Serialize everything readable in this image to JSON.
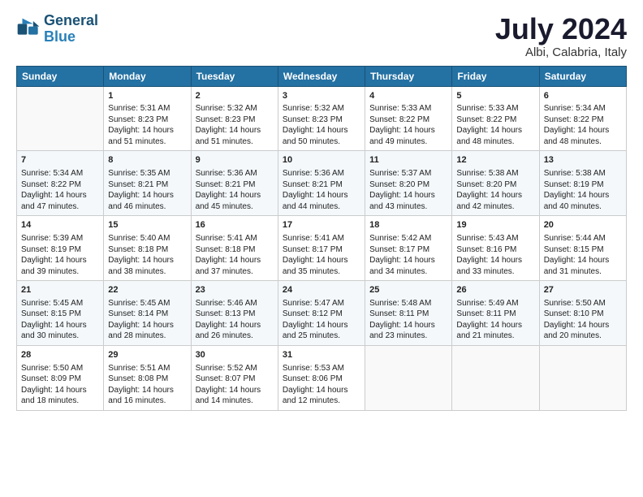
{
  "header": {
    "logo_line1": "General",
    "logo_line2": "Blue",
    "month": "July 2024",
    "location": "Albi, Calabria, Italy"
  },
  "days_of_week": [
    "Sunday",
    "Monday",
    "Tuesday",
    "Wednesday",
    "Thursday",
    "Friday",
    "Saturday"
  ],
  "weeks": [
    [
      {
        "day": "",
        "info": ""
      },
      {
        "day": "1",
        "info": "Sunrise: 5:31 AM\nSunset: 8:23 PM\nDaylight: 14 hours\nand 51 minutes."
      },
      {
        "day": "2",
        "info": "Sunrise: 5:32 AM\nSunset: 8:23 PM\nDaylight: 14 hours\nand 51 minutes."
      },
      {
        "day": "3",
        "info": "Sunrise: 5:32 AM\nSunset: 8:23 PM\nDaylight: 14 hours\nand 50 minutes."
      },
      {
        "day": "4",
        "info": "Sunrise: 5:33 AM\nSunset: 8:22 PM\nDaylight: 14 hours\nand 49 minutes."
      },
      {
        "day": "5",
        "info": "Sunrise: 5:33 AM\nSunset: 8:22 PM\nDaylight: 14 hours\nand 48 minutes."
      },
      {
        "day": "6",
        "info": "Sunrise: 5:34 AM\nSunset: 8:22 PM\nDaylight: 14 hours\nand 48 minutes."
      }
    ],
    [
      {
        "day": "7",
        "info": "Sunrise: 5:34 AM\nSunset: 8:22 PM\nDaylight: 14 hours\nand 47 minutes."
      },
      {
        "day": "8",
        "info": "Sunrise: 5:35 AM\nSunset: 8:21 PM\nDaylight: 14 hours\nand 46 minutes."
      },
      {
        "day": "9",
        "info": "Sunrise: 5:36 AM\nSunset: 8:21 PM\nDaylight: 14 hours\nand 45 minutes."
      },
      {
        "day": "10",
        "info": "Sunrise: 5:36 AM\nSunset: 8:21 PM\nDaylight: 14 hours\nand 44 minutes."
      },
      {
        "day": "11",
        "info": "Sunrise: 5:37 AM\nSunset: 8:20 PM\nDaylight: 14 hours\nand 43 minutes."
      },
      {
        "day": "12",
        "info": "Sunrise: 5:38 AM\nSunset: 8:20 PM\nDaylight: 14 hours\nand 42 minutes."
      },
      {
        "day": "13",
        "info": "Sunrise: 5:38 AM\nSunset: 8:19 PM\nDaylight: 14 hours\nand 40 minutes."
      }
    ],
    [
      {
        "day": "14",
        "info": "Sunrise: 5:39 AM\nSunset: 8:19 PM\nDaylight: 14 hours\nand 39 minutes."
      },
      {
        "day": "15",
        "info": "Sunrise: 5:40 AM\nSunset: 8:18 PM\nDaylight: 14 hours\nand 38 minutes."
      },
      {
        "day": "16",
        "info": "Sunrise: 5:41 AM\nSunset: 8:18 PM\nDaylight: 14 hours\nand 37 minutes."
      },
      {
        "day": "17",
        "info": "Sunrise: 5:41 AM\nSunset: 8:17 PM\nDaylight: 14 hours\nand 35 minutes."
      },
      {
        "day": "18",
        "info": "Sunrise: 5:42 AM\nSunset: 8:17 PM\nDaylight: 14 hours\nand 34 minutes."
      },
      {
        "day": "19",
        "info": "Sunrise: 5:43 AM\nSunset: 8:16 PM\nDaylight: 14 hours\nand 33 minutes."
      },
      {
        "day": "20",
        "info": "Sunrise: 5:44 AM\nSunset: 8:15 PM\nDaylight: 14 hours\nand 31 minutes."
      }
    ],
    [
      {
        "day": "21",
        "info": "Sunrise: 5:45 AM\nSunset: 8:15 PM\nDaylight: 14 hours\nand 30 minutes."
      },
      {
        "day": "22",
        "info": "Sunrise: 5:45 AM\nSunset: 8:14 PM\nDaylight: 14 hours\nand 28 minutes."
      },
      {
        "day": "23",
        "info": "Sunrise: 5:46 AM\nSunset: 8:13 PM\nDaylight: 14 hours\nand 26 minutes."
      },
      {
        "day": "24",
        "info": "Sunrise: 5:47 AM\nSunset: 8:12 PM\nDaylight: 14 hours\nand 25 minutes."
      },
      {
        "day": "25",
        "info": "Sunrise: 5:48 AM\nSunset: 8:11 PM\nDaylight: 14 hours\nand 23 minutes."
      },
      {
        "day": "26",
        "info": "Sunrise: 5:49 AM\nSunset: 8:11 PM\nDaylight: 14 hours\nand 21 minutes."
      },
      {
        "day": "27",
        "info": "Sunrise: 5:50 AM\nSunset: 8:10 PM\nDaylight: 14 hours\nand 20 minutes."
      }
    ],
    [
      {
        "day": "28",
        "info": "Sunrise: 5:50 AM\nSunset: 8:09 PM\nDaylight: 14 hours\nand 18 minutes."
      },
      {
        "day": "29",
        "info": "Sunrise: 5:51 AM\nSunset: 8:08 PM\nDaylight: 14 hours\nand 16 minutes."
      },
      {
        "day": "30",
        "info": "Sunrise: 5:52 AM\nSunset: 8:07 PM\nDaylight: 14 hours\nand 14 minutes."
      },
      {
        "day": "31",
        "info": "Sunrise: 5:53 AM\nSunset: 8:06 PM\nDaylight: 14 hours\nand 12 minutes."
      },
      {
        "day": "",
        "info": ""
      },
      {
        "day": "",
        "info": ""
      },
      {
        "day": "",
        "info": ""
      }
    ]
  ]
}
